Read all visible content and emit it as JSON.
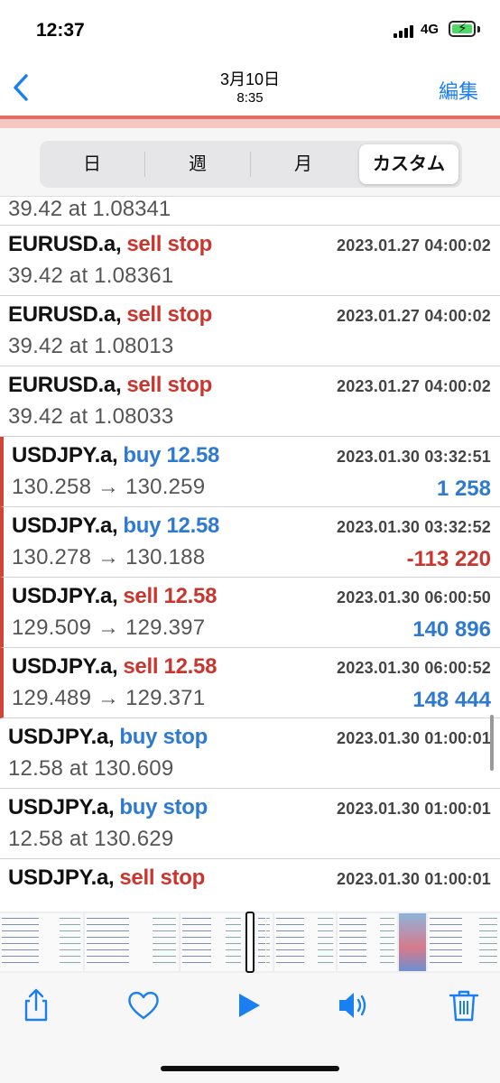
{
  "status_bar": {
    "time": "12:37",
    "network": "4G"
  },
  "nav": {
    "date": "3月10日",
    "time": "8:35",
    "edit_label": "編集"
  },
  "segments": [
    {
      "label": "日",
      "active": false
    },
    {
      "label": "週",
      "active": false
    },
    {
      "label": "月",
      "active": false
    },
    {
      "label": "カスタム",
      "active": true
    }
  ],
  "partial_row": {
    "detail": "39.42 at 1.08341"
  },
  "orders": [
    {
      "symbol": "EURUSD.a,",
      "action": "sell stop",
      "side": "sell",
      "datetime": "2023.01.27 04:00:02",
      "detail": "39.42 at 1.08361",
      "profit": ""
    },
    {
      "symbol": "EURUSD.a,",
      "action": "sell stop",
      "side": "sell",
      "datetime": "2023.01.27 04:00:02",
      "detail": "39.42 at 1.08013",
      "profit": ""
    },
    {
      "symbol": "EURUSD.a,",
      "action": "sell stop",
      "side": "sell",
      "datetime": "2023.01.27 04:00:02",
      "detail": "39.42 at 1.08033",
      "profit": ""
    },
    {
      "symbol": "USDJPY.a,",
      "action": "buy 12.58",
      "side": "buy",
      "datetime": "2023.01.30 03:32:51",
      "detail": "130.258 → 130.259",
      "profit": "1 258",
      "profit_sign": "pos",
      "marked": true
    },
    {
      "symbol": "USDJPY.a,",
      "action": "buy 12.58",
      "side": "buy",
      "datetime": "2023.01.30 03:32:52",
      "detail": "130.278 → 130.188",
      "profit": "-113 220",
      "profit_sign": "neg",
      "marked": true
    },
    {
      "symbol": "USDJPY.a,",
      "action": "sell 12.58",
      "side": "sell",
      "datetime": "2023.01.30 06:00:50",
      "detail": "129.509 → 129.397",
      "profit": "140 896",
      "profit_sign": "pos",
      "marked": true
    },
    {
      "symbol": "USDJPY.a,",
      "action": "sell 12.58",
      "side": "sell",
      "datetime": "2023.01.30 06:00:52",
      "detail": "129.489 → 129.371",
      "profit": "148 444",
      "profit_sign": "pos",
      "marked": true
    },
    {
      "symbol": "USDJPY.a,",
      "action": "buy stop",
      "side": "buy",
      "datetime": "2023.01.30 01:00:01",
      "detail": "12.58 at 130.609",
      "profit": ""
    },
    {
      "symbol": "USDJPY.a,",
      "action": "buy stop",
      "side": "buy",
      "datetime": "2023.01.30 01:00:01",
      "detail": "12.58 at 130.629",
      "profit": ""
    },
    {
      "symbol": "USDJPY.a,",
      "action": "sell stop",
      "side": "sell",
      "datetime": "2023.01.30 01:00:01",
      "detail": "",
      "profit": ""
    }
  ],
  "toolbar": {
    "icons": [
      "share-icon",
      "heart-icon",
      "play-icon",
      "speaker-icon",
      "trash-icon"
    ]
  },
  "colors": {
    "accent": "#1a7ff0",
    "sell": "#c9362e",
    "buy": "#2f7ad1",
    "marker": "#d0453a"
  }
}
